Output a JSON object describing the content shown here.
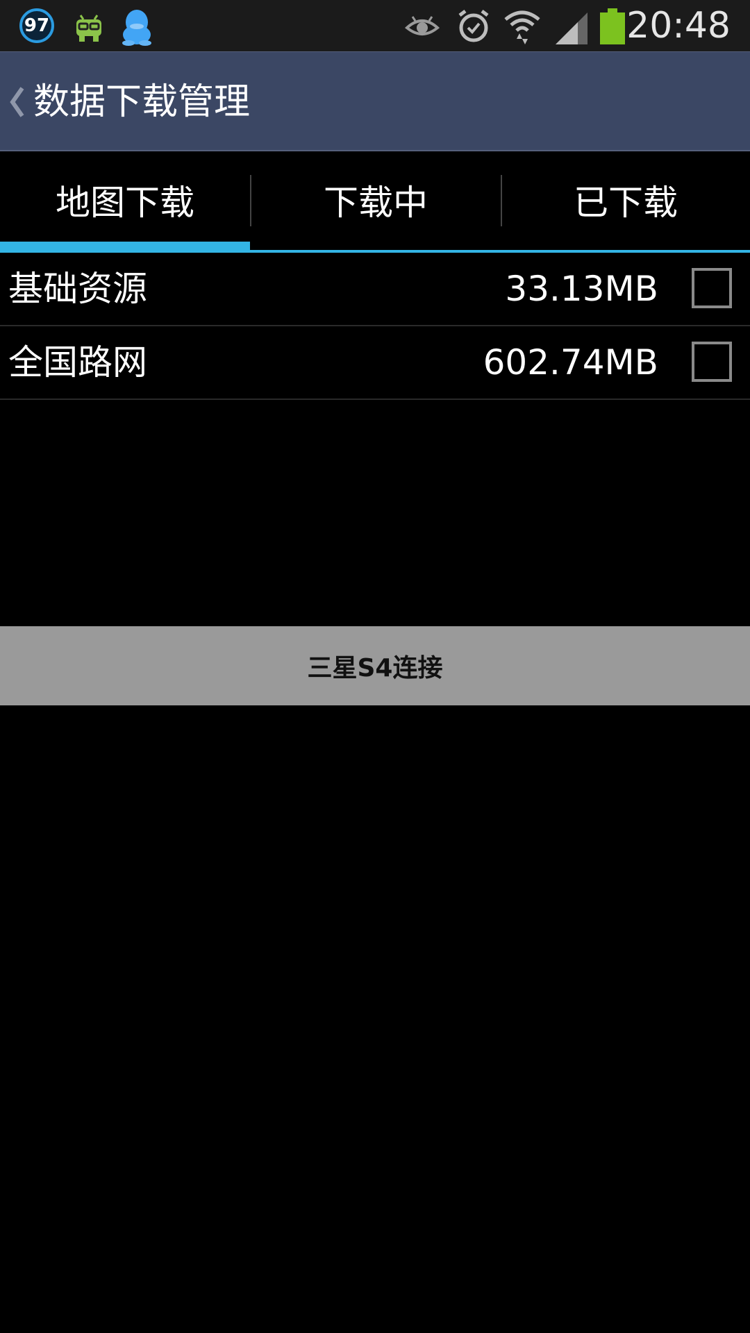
{
  "status_bar": {
    "badge_value": "97",
    "time": "20:48",
    "icons": [
      "badge-icon",
      "android-icon",
      "qq-penguin-icon",
      "eye-icon",
      "alarm-icon",
      "wifi-icon",
      "signal-icon",
      "battery-icon"
    ],
    "colors": {
      "badge_ring": "#2b9be0",
      "android": "#8bc34a",
      "qq": "#42a5f5",
      "battery": "#7cc21f"
    }
  },
  "action_bar": {
    "title": "数据下载管理",
    "background": "#3b4764"
  },
  "tabs": [
    {
      "label": "地图下载",
      "selected": true
    },
    {
      "label": "下载中",
      "selected": false
    },
    {
      "label": "已下载",
      "selected": false
    }
  ],
  "accent_color": "#33b5e5",
  "downloads": [
    {
      "name": "基础资源",
      "size": "33.13MB",
      "checked": false
    },
    {
      "name": "全国路网",
      "size": "602.74MB",
      "checked": false
    }
  ],
  "connect_button": {
    "label": "三星S4连接"
  }
}
